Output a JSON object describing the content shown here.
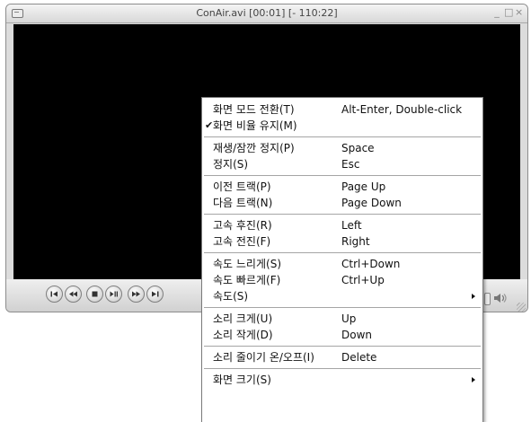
{
  "window": {
    "title": "ConAir.avi [00:01] [- 110:22]",
    "controls": [
      "_",
      "□",
      "×"
    ]
  },
  "transport": {
    "buttons": [
      "prev-icon",
      "rewind-icon",
      "stop-icon",
      "play-pause-icon",
      "fast-forward-icon",
      "next-icon"
    ]
  },
  "menu": {
    "groups": [
      [
        {
          "label": "화면 모드 전환(T)",
          "shortcut": "Alt-Enter, Double-click",
          "checked": false,
          "submenu": false
        },
        {
          "label": "화면 비율 유지(M)",
          "shortcut": "",
          "checked": true,
          "submenu": false
        }
      ],
      [
        {
          "label": "재생/잠깐 정지(P)",
          "shortcut": "Space",
          "checked": false,
          "submenu": false
        },
        {
          "label": "정지(S)",
          "shortcut": "Esc",
          "checked": false,
          "submenu": false
        }
      ],
      [
        {
          "label": "이전 트랙(P)",
          "shortcut": "Page Up",
          "checked": false,
          "submenu": false
        },
        {
          "label": "다음 트랙(N)",
          "shortcut": "Page Down",
          "checked": false,
          "submenu": false
        }
      ],
      [
        {
          "label": "고속 후진(R)",
          "shortcut": "Left",
          "checked": false,
          "submenu": false
        },
        {
          "label": "고속 전진(F)",
          "shortcut": "Right",
          "checked": false,
          "submenu": false
        }
      ],
      [
        {
          "label": "속도 느리게(S)",
          "shortcut": "Ctrl+Down",
          "checked": false,
          "submenu": false
        },
        {
          "label": "속도 빠르게(F)",
          "shortcut": "Ctrl+Up",
          "checked": false,
          "submenu": false
        },
        {
          "label": "속도(S)",
          "shortcut": "",
          "checked": false,
          "submenu": true
        }
      ],
      [
        {
          "label": "소리 크게(U)",
          "shortcut": "Up",
          "checked": false,
          "submenu": false
        },
        {
          "label": "소리 작게(D)",
          "shortcut": "Down",
          "checked": false,
          "submenu": false
        }
      ],
      [
        {
          "label": "소리 줄이기 온/오프(I)",
          "shortcut": "Delete",
          "checked": false,
          "submenu": false
        }
      ],
      [
        {
          "label": "화면 크기(S)",
          "shortcut": "",
          "checked": false,
          "submenu": true
        }
      ]
    ]
  },
  "colors": {
    "video_bg": "#000000",
    "menu_bg": "#ffffff",
    "chrome": "#dcdcdc"
  }
}
